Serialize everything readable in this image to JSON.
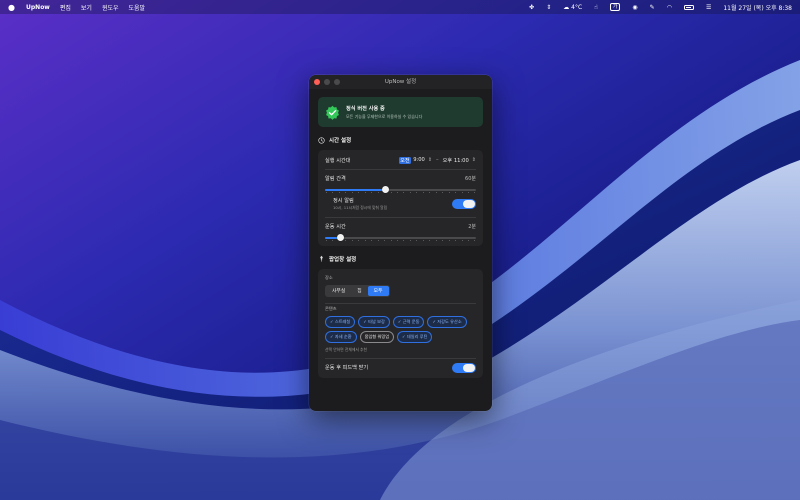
{
  "menubar": {
    "app_name": "UpNow",
    "menus": [
      "편집",
      "보기",
      "윈도우",
      "도움말"
    ],
    "weather": "4°C",
    "datetime": "11월 27일 (목) 오후 8:38"
  },
  "window": {
    "title": "UpNow 설정",
    "banner": {
      "title": "정식 버전 사용 중",
      "subtitle": "모든 기능을 무제한으로 이용하실 수 있습니다"
    },
    "time_section": {
      "header": "시간 설정",
      "active_hours_label": "실행 시간대",
      "start_ampm": "오전",
      "start_time": "9:00",
      "end_time": "오후 11:00",
      "interval_label": "알림 간격",
      "interval_value": "60분",
      "interval_slider_fraction": 0.4,
      "hourly_title": "정시 알림",
      "hourly_desc": "10시, 11시처럼 정시에 맞춰 알림",
      "hourly_on": true,
      "exercise_label": "운동 시간",
      "exercise_value": "2분",
      "exercise_slider_fraction": 0.1
    },
    "popup_section": {
      "header": "팝업창 설정",
      "place_label": "장소",
      "place_options": [
        "사무실",
        "집",
        "모두"
      ],
      "place_selected": "모두",
      "content_label": "콘텐츠",
      "chips": [
        {
          "label": "✓ 스트레칭",
          "on": true
        },
        {
          "label": "✓ 타납 보강",
          "on": true
        },
        {
          "label": "✓ 근력 운동",
          "on": true
        },
        {
          "label": "✓ 저강도 유산소",
          "on": true
        },
        {
          "label": "✓ 자세 순환",
          "on": true
        },
        {
          "label": "몸입형 워밍업",
          "on": false
        },
        {
          "label": "✓ 데일리 루틴",
          "on": true
        }
      ],
      "content_hint": "선택 안하면 전체에서 추천",
      "feedback_label": "운동 후 피드백 받기",
      "feedback_on": true
    }
  },
  "colors": {
    "accent": "#2f7bf5",
    "banner_bg": "#1f3b2f",
    "check_green": "#34c759",
    "window_bg": "#1c1c1e"
  }
}
